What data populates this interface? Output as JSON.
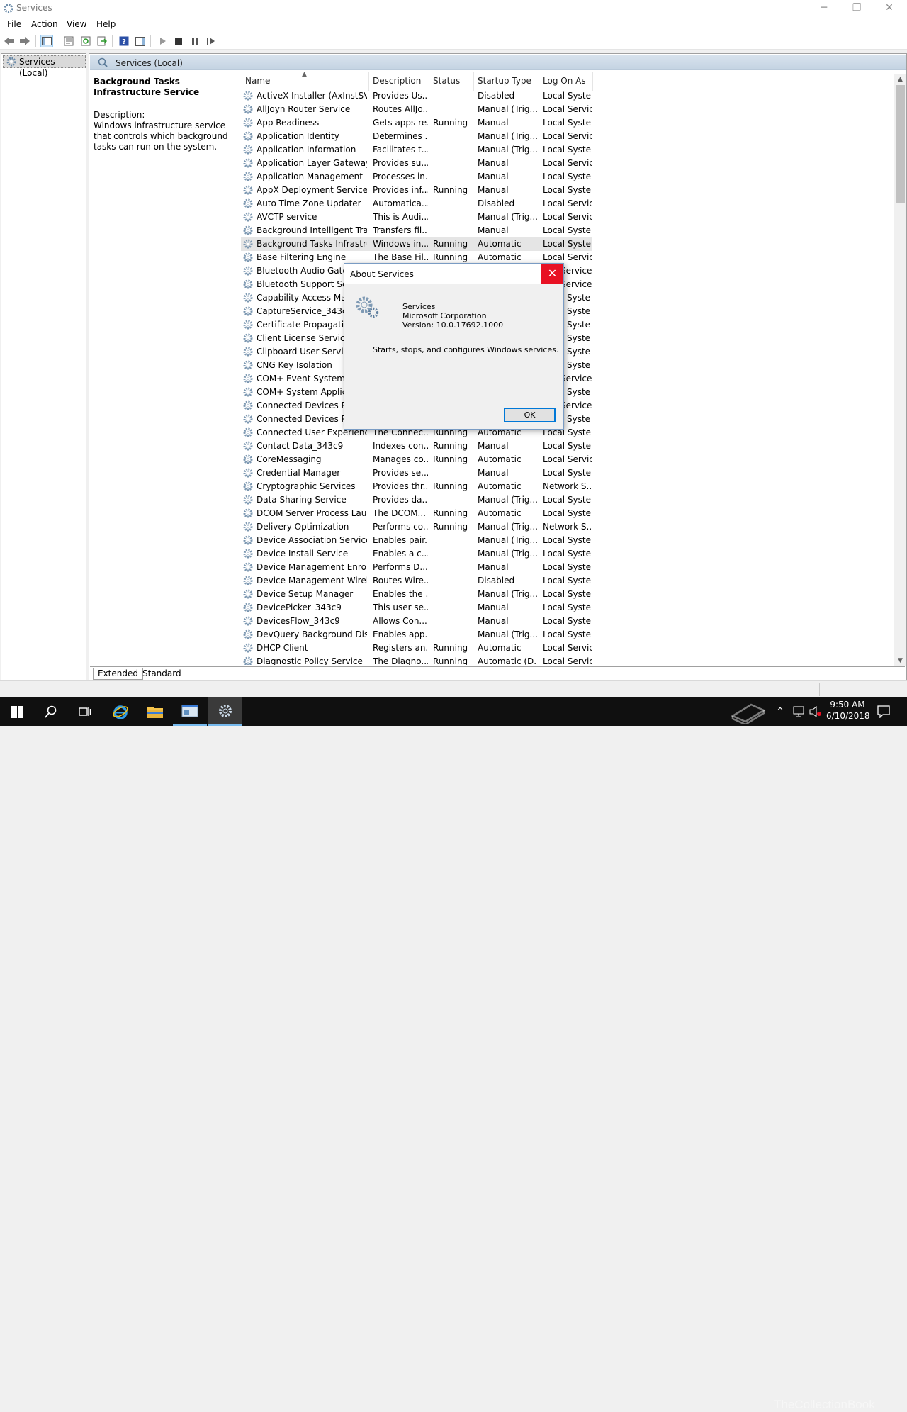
{
  "window": {
    "title": "Services"
  },
  "menu": [
    "File",
    "Action",
    "View",
    "Help"
  ],
  "tree": {
    "root": "Services (Local)"
  },
  "pane_header": "Services (Local)",
  "detail": {
    "title": "Background Tasks Infrastructure Service",
    "label": "Description:",
    "text": "Windows infrastructure service that controls which background tasks can run on the system."
  },
  "columns": [
    "Name",
    "Description",
    "Status",
    "Startup Type",
    "Log On As"
  ],
  "services": [
    [
      "ActiveX Installer (AxInstSV)",
      "Provides Us...",
      "",
      "Disabled",
      "Local Syste"
    ],
    [
      "AllJoyn Router Service",
      "Routes AllJo...",
      "",
      "Manual (Trig...",
      "Local Service"
    ],
    [
      "App Readiness",
      "Gets apps re...",
      "Running",
      "Manual",
      "Local Syste"
    ],
    [
      "Application Identity",
      "Determines ...",
      "",
      "Manual (Trig...",
      "Local Service"
    ],
    [
      "Application Information",
      "Facilitates t...",
      "",
      "Manual (Trig...",
      "Local Syste"
    ],
    [
      "Application Layer Gateway ...",
      "Provides su...",
      "",
      "Manual",
      "Local Service"
    ],
    [
      "Application Management",
      "Processes in...",
      "",
      "Manual",
      "Local Syste"
    ],
    [
      "AppX Deployment Service (...",
      "Provides inf...",
      "Running",
      "Manual",
      "Local Syste"
    ],
    [
      "Auto Time Zone Updater",
      "Automatica...",
      "",
      "Disabled",
      "Local Service"
    ],
    [
      "AVCTP service",
      "This is Audi...",
      "",
      "Manual (Trig...",
      "Local Service"
    ],
    [
      "Background Intelligent Tran...",
      "Transfers fil...",
      "",
      "Manual",
      "Local Syste"
    ],
    [
      "Background Tasks Infrastru...",
      "Windows in...",
      "Running",
      "Automatic",
      "Local Syste"
    ],
    [
      "Base Filtering Engine",
      "The Base Fil...",
      "Running",
      "Automatic",
      "Local Service"
    ],
    [
      "Bluetooth Audio Gatew",
      "",
      "",
      "",
      "Service"
    ],
    [
      "Bluetooth Support Servi",
      "",
      "",
      "",
      "Service"
    ],
    [
      "Capability Access Mana",
      "",
      "",
      "",
      "Syste"
    ],
    [
      "CaptureService_343c9",
      "",
      "",
      "",
      "Syste"
    ],
    [
      "Certificate Propagation",
      "",
      "",
      "",
      "Syste"
    ],
    [
      "Client License Service (C",
      "",
      "",
      "",
      "Syste"
    ],
    [
      "Clipboard User Service_",
      "",
      "",
      "",
      "Syste"
    ],
    [
      "CNG Key Isolation",
      "",
      "",
      "",
      "Syste"
    ],
    [
      "COM+ Event System",
      "",
      "",
      "",
      "Service"
    ],
    [
      "COM+ System Applicat",
      "",
      "",
      "",
      "Syste"
    ],
    [
      "Connected Devices Plat",
      "",
      "",
      "",
      "Service"
    ],
    [
      "Connected Devices Plat",
      "",
      "",
      "",
      "Syste"
    ],
    [
      "Connected User Experience...",
      "The Connec...",
      "Running",
      "Automatic",
      "Local Syste"
    ],
    [
      "Contact Data_343c9",
      "Indexes con...",
      "Running",
      "Manual",
      "Local Syste"
    ],
    [
      "CoreMessaging",
      "Manages co...",
      "Running",
      "Automatic",
      "Local Service"
    ],
    [
      "Credential Manager",
      "Provides se...",
      "",
      "Manual",
      "Local Syste"
    ],
    [
      "Cryptographic Services",
      "Provides thr...",
      "Running",
      "Automatic",
      "Network S..."
    ],
    [
      "Data Sharing Service",
      "Provides da...",
      "",
      "Manual (Trig...",
      "Local Syste"
    ],
    [
      "DCOM Server Process Laun...",
      "The DCOM...",
      "Running",
      "Automatic",
      "Local Syste"
    ],
    [
      "Delivery Optimization",
      "Performs co...",
      "Running",
      "Manual (Trig...",
      "Network S..."
    ],
    [
      "Device Association Service",
      "Enables pair...",
      "",
      "Manual (Trig...",
      "Local Syste"
    ],
    [
      "Device Install Service",
      "Enables a c...",
      "",
      "Manual (Trig...",
      "Local Syste"
    ],
    [
      "Device Management Enroll...",
      "Performs D...",
      "",
      "Manual",
      "Local Syste"
    ],
    [
      "Device Management Wirele...",
      "Routes Wire...",
      "",
      "Disabled",
      "Local Syste"
    ],
    [
      "Device Setup Manager",
      "Enables the ...",
      "",
      "Manual (Trig...",
      "Local Syste"
    ],
    [
      "DevicePicker_343c9",
      "This user se...",
      "",
      "Manual",
      "Local Syste"
    ],
    [
      "DevicesFlow_343c9",
      "Allows Con...",
      "",
      "Manual",
      "Local Syste"
    ],
    [
      "DevQuery Background Disc...",
      "Enables app...",
      "",
      "Manual (Trig...",
      "Local Syste"
    ],
    [
      "DHCP Client",
      "Registers an...",
      "Running",
      "Automatic",
      "Local Service"
    ],
    [
      "Diagnostic Policy Service",
      "The Diagno...",
      "Running",
      "Automatic (D...",
      "Local Service"
    ]
  ],
  "selected_row": 11,
  "tabs": [
    "Extended",
    "Standard"
  ],
  "dialog": {
    "title": "About Services",
    "app_name": "Services",
    "company": "Microsoft Corporation",
    "version": "Version: 10.0.17692.1000",
    "description": "Starts, stops, and configures Windows services.",
    "ok": "OK",
    "close": "✕"
  },
  "taskbar": {
    "time": "9:50 AM",
    "date": "6/10/2018"
  },
  "watermark": "TheCollectionBook",
  "colors": {
    "accent": "#0078d7",
    "close_red": "#e81123",
    "taskbar": "#101010"
  }
}
